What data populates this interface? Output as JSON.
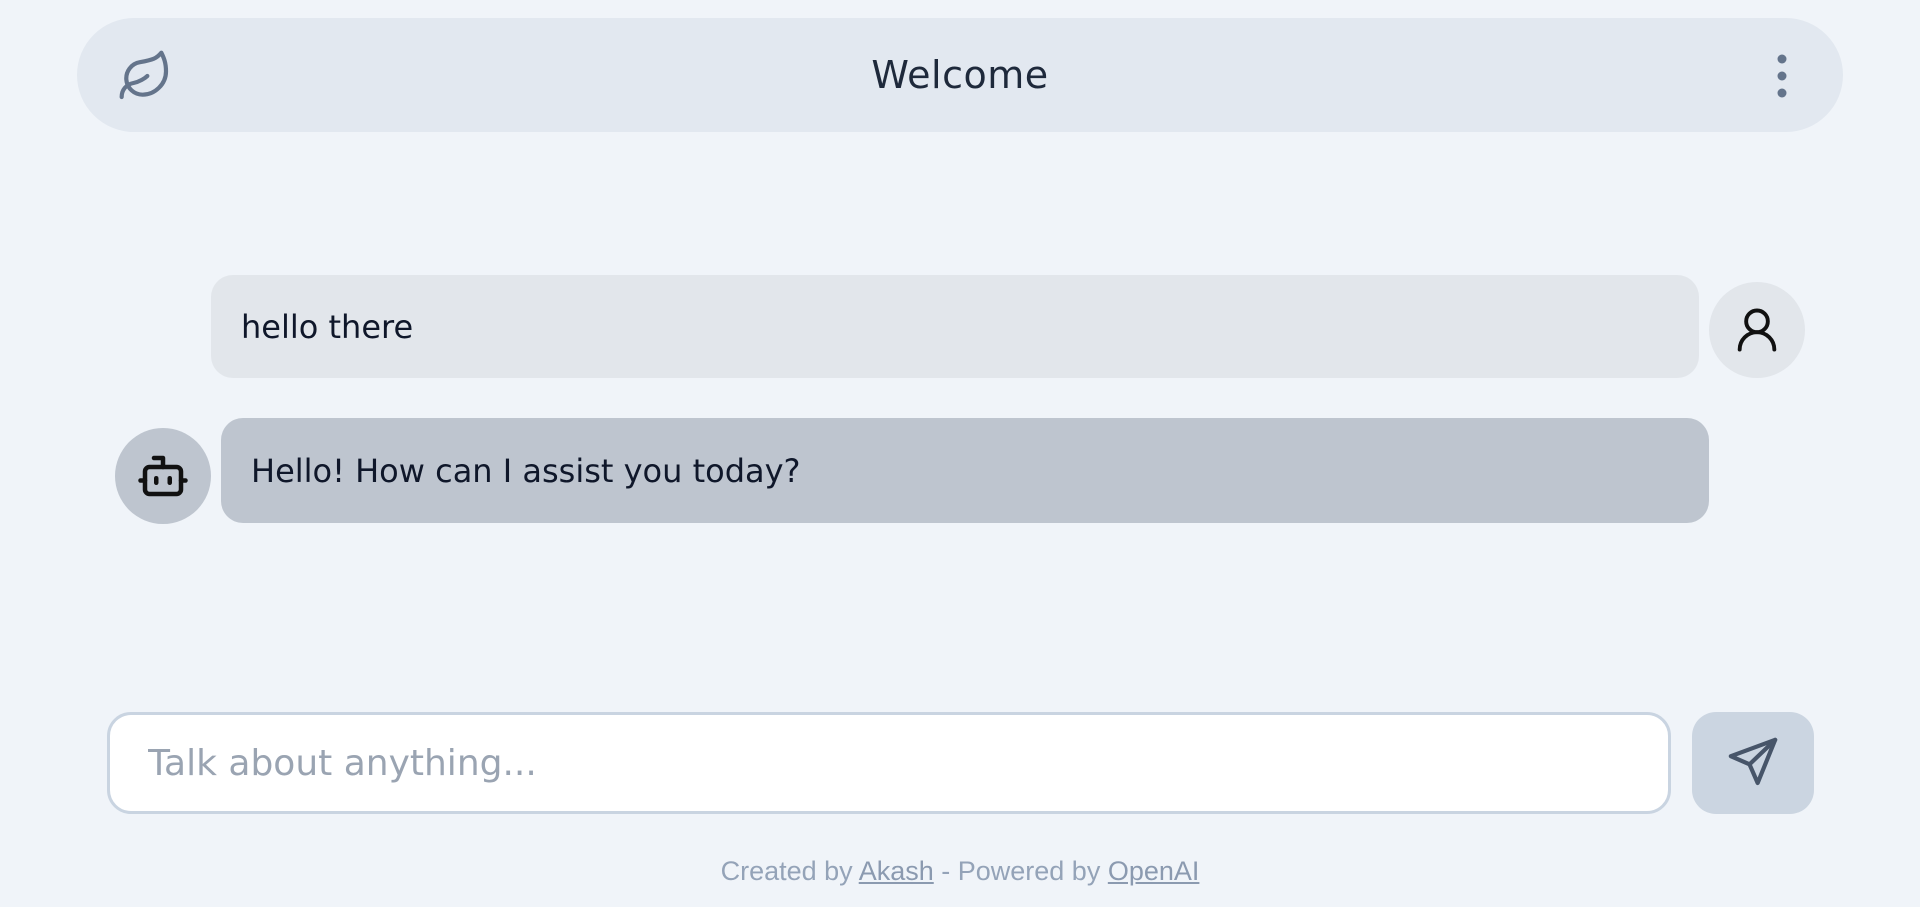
{
  "header": {
    "title": "Welcome",
    "logo_icon": "leaf-icon",
    "menu_icon": "more-vertical-icon"
  },
  "messages": [
    {
      "role": "user",
      "text": "hello there",
      "avatar_icon": "user-icon"
    },
    {
      "role": "bot",
      "text": "Hello! How can I assist you today?",
      "avatar_icon": "robot-icon"
    }
  ],
  "composer": {
    "placeholder": "Talk about anything...",
    "value": "",
    "send_icon": "send-icon"
  },
  "footer": {
    "created_by_prefix": "Created by ",
    "author_link": "Akash",
    "separator": " - Powered by ",
    "powered_link": "OpenAI"
  },
  "colors": {
    "background": "#f0f4f9",
    "header_bg": "#e2e8f0",
    "user_bubble": "#e2e6eb",
    "bot_bubble": "#bec5cf",
    "send_button": "#cbd5e1",
    "icon_gray": "#64748b"
  }
}
